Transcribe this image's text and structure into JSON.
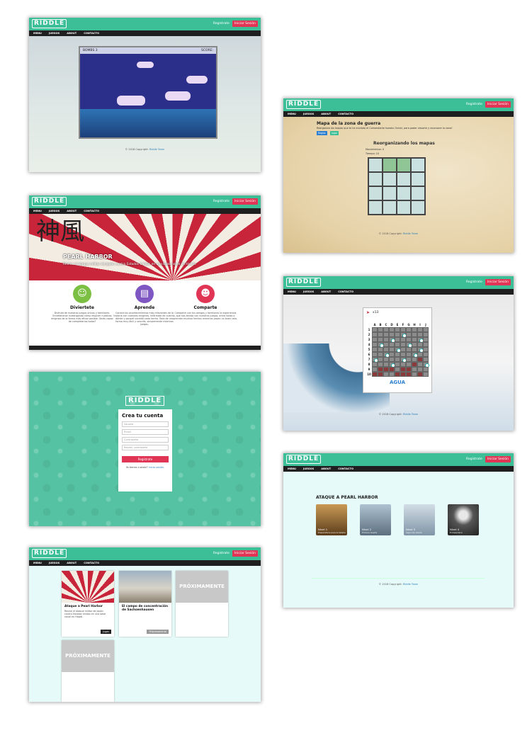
{
  "common": {
    "logo": "RIDDLE",
    "register": "Regístrate",
    "login": "Iniciar Sesión",
    "nav": [
      "MENU",
      "JUEGOS",
      "ABOUT",
      "CONTACTO"
    ],
    "footer_prefix": "© 2018 Copyright:",
    "footer_link": "Riddle Team"
  },
  "game1": {
    "bombs_label": "BOMBS 3",
    "score_label": "SCORE:"
  },
  "home": {
    "kanji": "神風",
    "hero_title": "PEARL HARBOR",
    "hero_subtitle": "Revive el ataque militar de Japón contra Estados Unidos en una base naval en Hawái.",
    "features": [
      {
        "title": "Diviertete",
        "text": "Disfruta de nuestros juegos únicos y familiares. Entretenerse investigando cómo resolver nuestros enigmas de la forma más eficaz posible. Serás capaz de completarlos todos?",
        "color": "#7bc043",
        "icon": "smile-icon",
        "glyph": "☺"
      },
      {
        "title": "Aprende",
        "text": "Conoce los acontecimientos más relevantes de la historia con nuestros enigmas. Infórmate de cuándo, dónde y porqué sucedió cada hecho. Todo de una forma muy fácil y sencilla, simplemente mientras juegas.",
        "color": "#7e57c2",
        "icon": "book-icon",
        "glyph": "▤"
      },
      {
        "title": "Comparte",
        "text": "Comparte con tus amigos y familiares la experiencia que has tenido con nuestros juegos, entre todos a prender muchos hechos mientras pasan un buen rato.",
        "color": "#e03554",
        "icon": "people-icon",
        "glyph": "☻"
      }
    ]
  },
  "signup": {
    "title": "Crea tu cuenta",
    "placeholders": [
      "Usuario",
      "Email",
      "Contraseña",
      "Repetir contraseña"
    ],
    "button": "Regístrate",
    "question": "Ya tienes cuenta?",
    "login_link": "Inicia sesión."
  },
  "games": {
    "cards": [
      {
        "title": "Ataque a Pearl Harbor",
        "text": "Revive el ataque militar de Japón contra Estados Unidos en una base naval en Hawái.",
        "button": "Jugar",
        "button_color": "#222222"
      },
      {
        "title": "El campo de concentración de Sachsenhausen",
        "text": "",
        "button": "Próximamente",
        "button_color": "#999999"
      }
    ],
    "soon": "PRÓXIMAMENTE"
  },
  "map": {
    "title": "Mapa de la zona de guerra",
    "text": "Reorganiza los mapas que te ha enviado el Comandante Isoroku Onishi, para poder situarte y reconocer la zona!",
    "buttons": [
      {
        "label": "Reglas",
        "color": "#2d7fd0"
      },
      {
        "label": "Jugar",
        "color": "#3cbf96"
      }
    ],
    "subtitle": "Reorganizando los mapas",
    "moves_label": "Movimientos: 0",
    "time_label": "Tiempo: 10"
  },
  "battleship": {
    "count": "x13",
    "columns": [
      "A",
      "B",
      "C",
      "D",
      "E",
      "F",
      "G",
      "H",
      "I",
      "J"
    ],
    "rows": [
      "1",
      "2",
      "3",
      "4",
      "5",
      "6",
      "7",
      "8",
      "9",
      "10"
    ],
    "result": "AGUA"
  },
  "levels": {
    "title": "ATAQUE A PEARL HARBOR",
    "items": [
      {
        "label": "Nivel 1",
        "desc": "Preparativos para la batalla",
        "color": "#7a5a2e"
      },
      {
        "label": "Nivel 2",
        "desc": "Primera oleada",
        "color": "#6f8aa0"
      },
      {
        "label": "Nivel 3",
        "desc": "Segunda oleada",
        "color": "#9bb0c0"
      },
      {
        "label": "Nivel 4",
        "desc": "El desenlace",
        "color": "#3a3a3a"
      }
    ]
  }
}
